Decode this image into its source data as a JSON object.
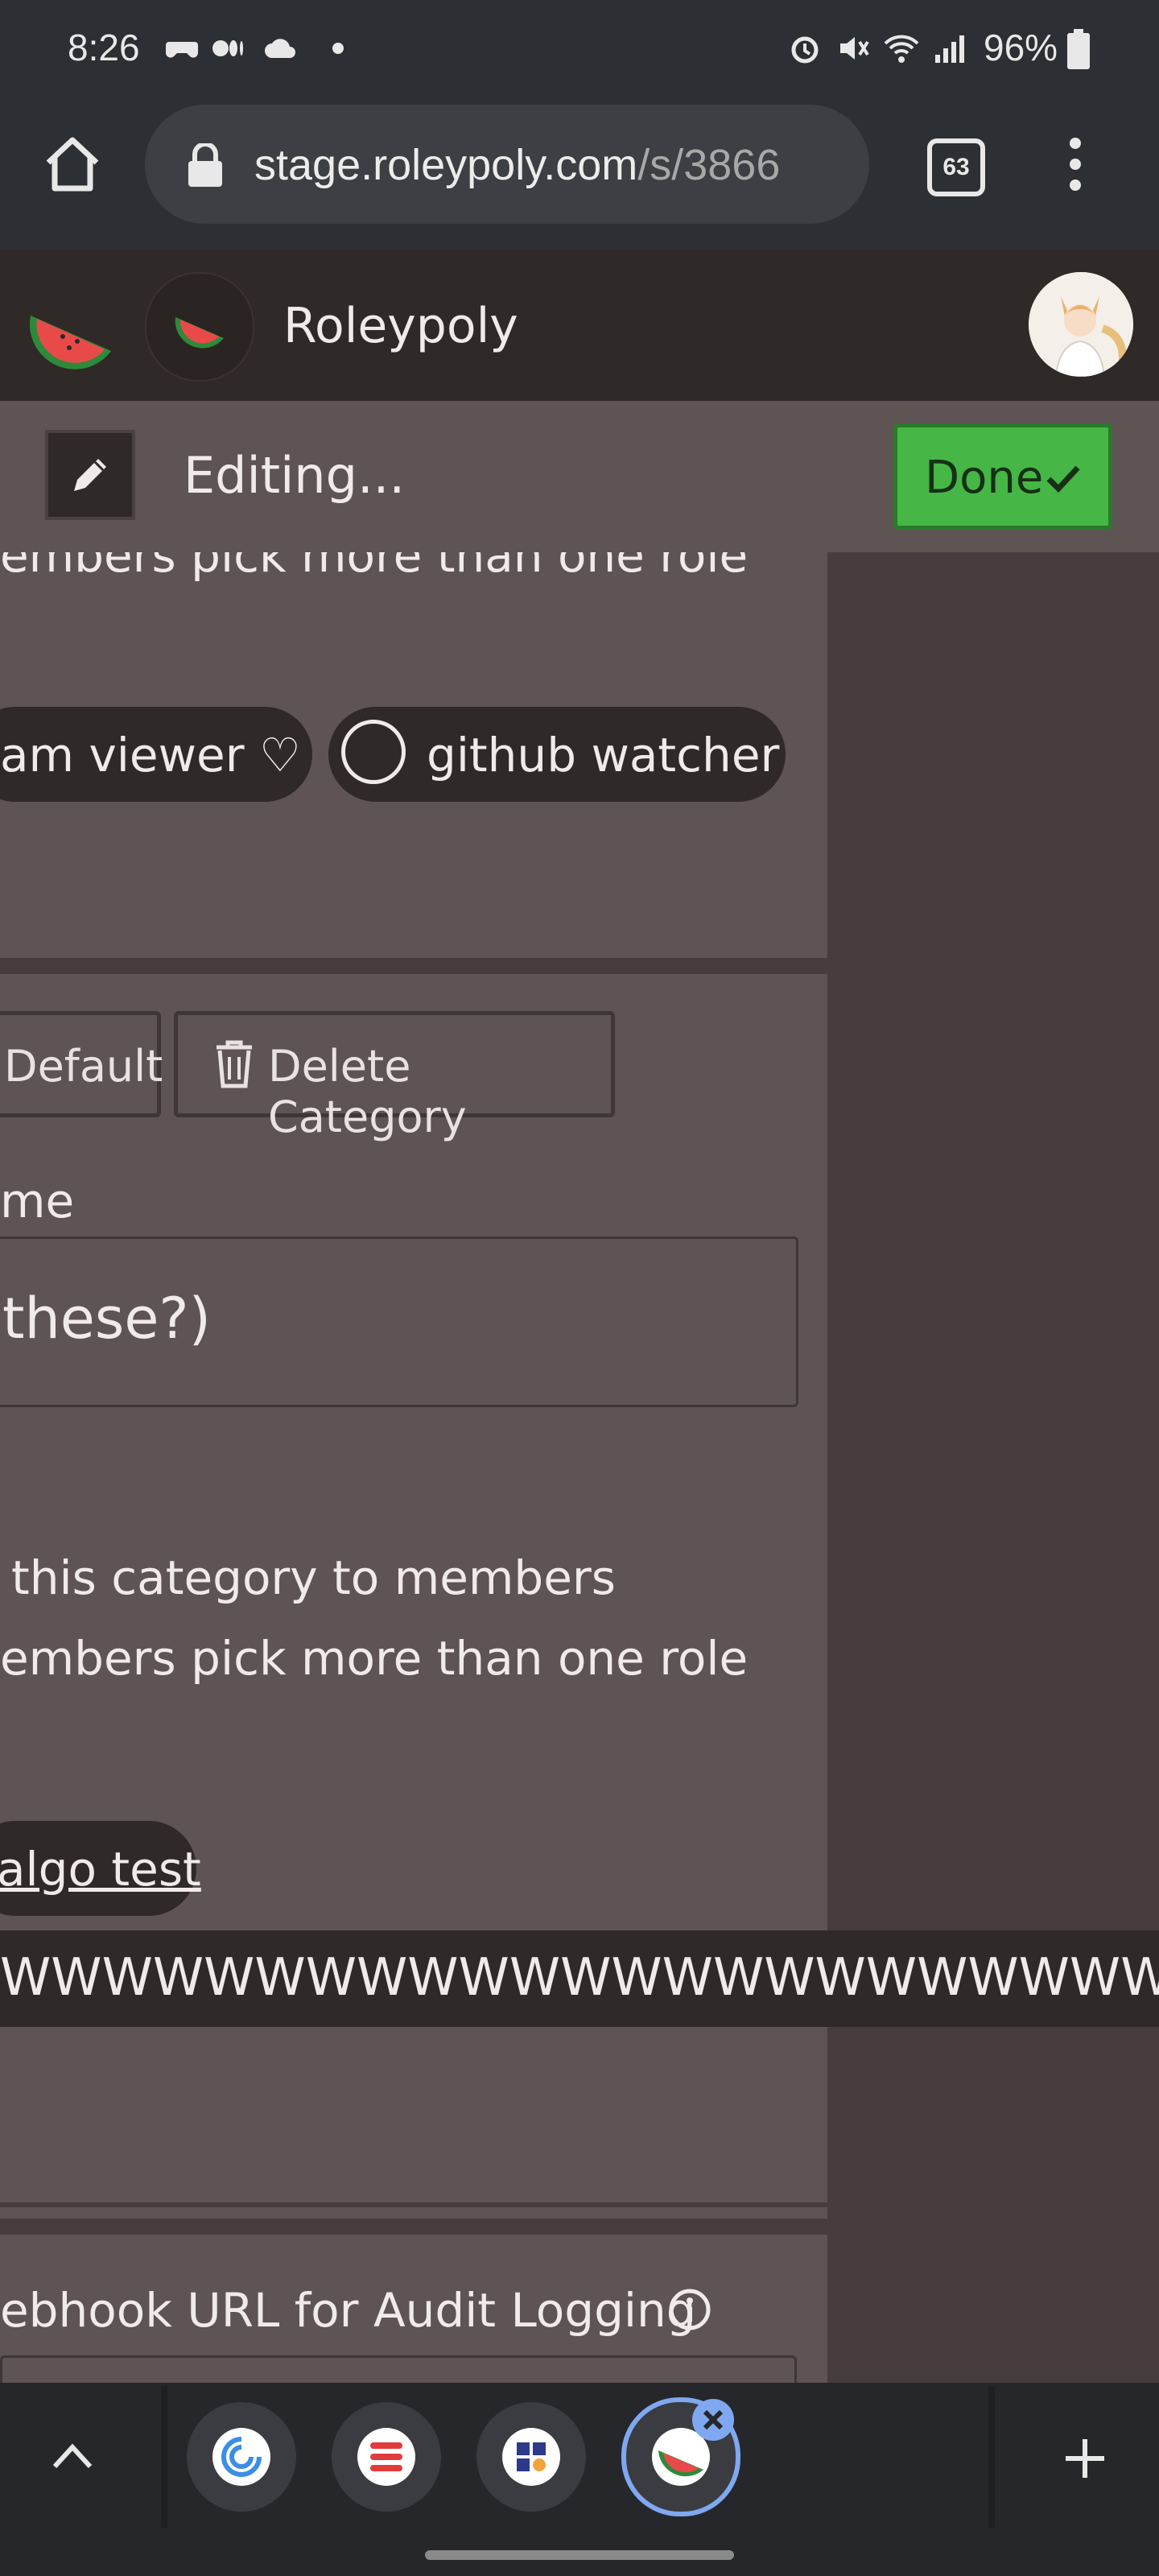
{
  "status_bar": {
    "time": "8:26",
    "battery": "96%"
  },
  "browser": {
    "url_main": "stage.roleypoly.com",
    "url_path": "/s/3866",
    "tab_count": "63"
  },
  "app": {
    "title": "Roleypoly"
  },
  "edit_bar": {
    "label": "Editing...",
    "done_label": "Done"
  },
  "category_top": {
    "multi_text_partial": "embers pick more than one role",
    "roles": [
      {
        "label": "am viewer ♡"
      },
      {
        "label": "github watcher"
      }
    ]
  },
  "category_edit": {
    "default_button": "Default",
    "delete_button": "Delete Category",
    "name_label_partial": "me",
    "name_value_partial": "these?)",
    "hidden_text_partial": "this category to members",
    "multi_text_partial": "embers pick more than one role",
    "role_chip": "algo test",
    "long_role": "WWWWWWWWWWWWWWWWWWWWWWWWWWWWWWWWWWWWWWWWWWW"
  },
  "webhook": {
    "label_partial": "ebhook URL for Audit Logging"
  },
  "colors": {
    "accent_green": "#46b646",
    "panel": "#5e5453",
    "dark": "#2f2928",
    "backdrop": "#463d3c"
  }
}
